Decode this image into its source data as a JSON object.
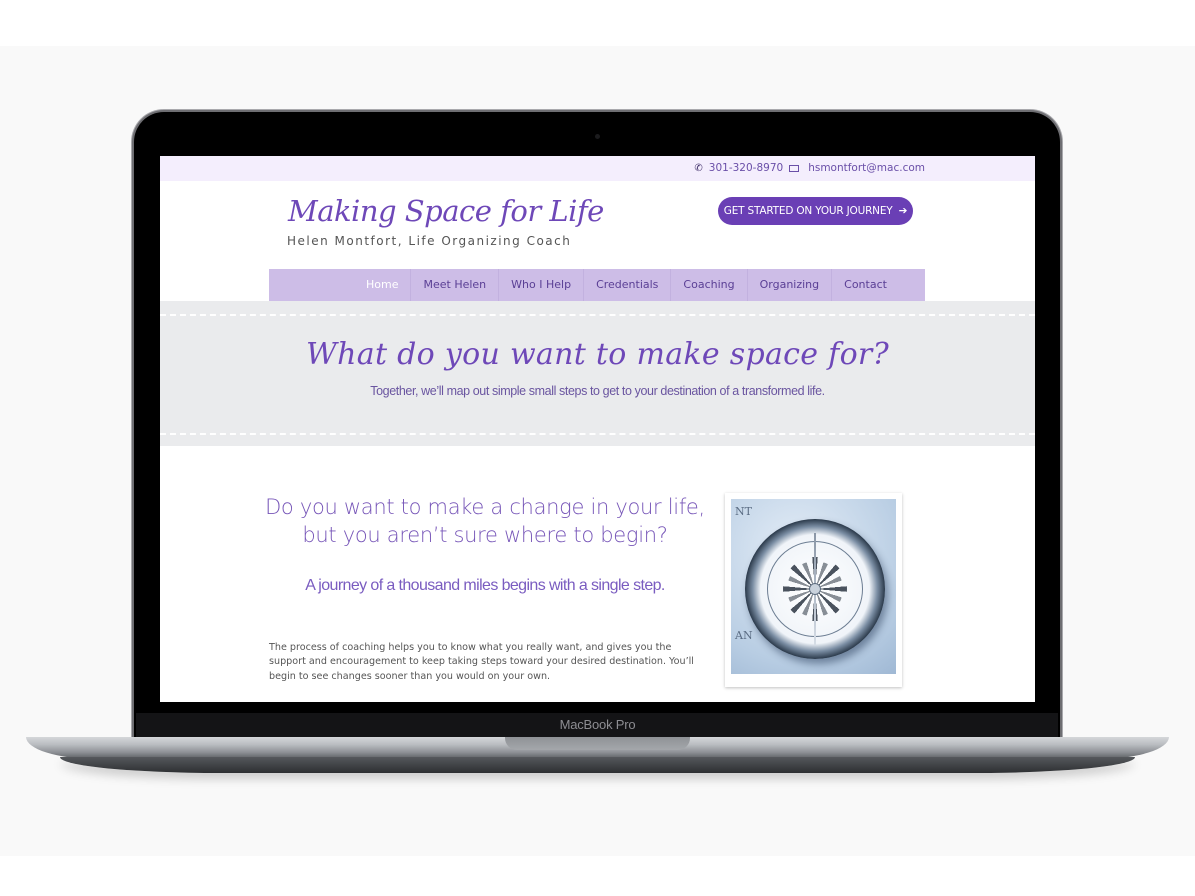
{
  "device": {
    "label": "MacBook Pro"
  },
  "site": {
    "topbar": {
      "phone_icon": "phone-icon",
      "phone": "301-320-8970",
      "email_icon": "envelope-icon",
      "email": "hsmontfort@mac.com"
    },
    "logo": {
      "title": "Making Space for Life",
      "subtitle": "Helen Montfort, Life Organizing Coach"
    },
    "cta": {
      "label": "GET STARTED ON YOUR JOURNEY",
      "icon": "arrow-right-icon",
      "glyph": "➔"
    },
    "nav": {
      "items": [
        {
          "label": "Home",
          "active": true
        },
        {
          "label": "Meet Helen",
          "active": false
        },
        {
          "label": "Who I Help",
          "active": false
        },
        {
          "label": "Credentials",
          "active": false
        },
        {
          "label": "Coaching",
          "active": false
        },
        {
          "label": "Organizing",
          "active": false
        },
        {
          "label": "Contact",
          "active": false
        }
      ]
    },
    "hero": {
      "title": "What do you want to make space for?",
      "subtitle": "Together, we’ll map out simple small steps to get to your destination of a transformed life."
    },
    "main": {
      "question": "Do you want to make a change in your life, but you aren’t sure where to begin?",
      "quote": "A journey of a thousand miles begins with a single step.",
      "body": "The process of coaching helps you to know what you really want, and gives you the support and encouragement to keep taking steps toward your desired destination. You’ll begin to see changes sooner than you would on your own.",
      "image_alt": "compass-on-map-photo",
      "map_letters": [
        "NT",
        "AN"
      ]
    },
    "colors": {
      "brand_purple": "#6a3fb5",
      "nav_background": "#cdbde7",
      "topbar_background": "#f4eefd",
      "hero_background": "#eaebed"
    }
  }
}
